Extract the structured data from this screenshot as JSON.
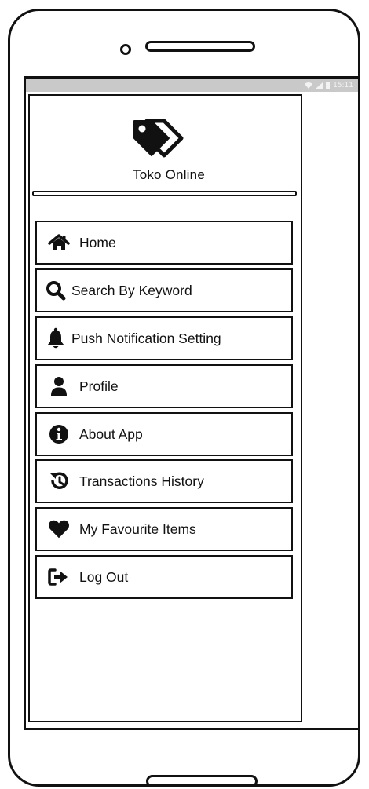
{
  "status_bar": {
    "time": "15:11",
    "icons": [
      "wifi-icon",
      "signal-icon",
      "battery-icon"
    ]
  },
  "app": {
    "title": "Toko Online",
    "logo_icon": "price-tag-icon"
  },
  "menu": {
    "items": [
      {
        "label": "Home",
        "icon": "home-icon"
      },
      {
        "label": "Search By Keyword",
        "icon": "search-icon"
      },
      {
        "label": "Push Notification Setting",
        "icon": "bell-icon"
      },
      {
        "label": "Profile",
        "icon": "user-icon"
      },
      {
        "label": "About App",
        "icon": "info-icon"
      },
      {
        "label": "Transactions History",
        "icon": "history-icon"
      },
      {
        "label": "My Favourite Items",
        "icon": "heart-icon"
      },
      {
        "label": "Log Out",
        "icon": "sign-out-icon"
      }
    ]
  },
  "colors": {
    "ink": "#111111",
    "status_bar": "#c9c9c9",
    "background": "#ffffff"
  }
}
